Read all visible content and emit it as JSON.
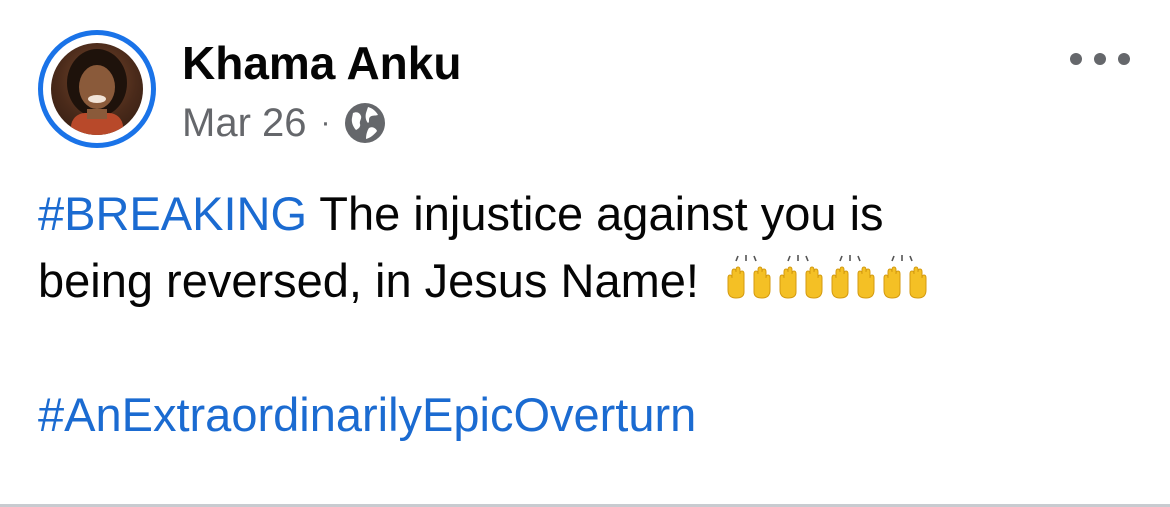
{
  "post": {
    "author": "Khama Anku",
    "date": "Mar 26",
    "separator": "·",
    "audience_icon": "globe-icon",
    "more_icon": "more-horizontal-icon",
    "text": {
      "hashtag_1": "#BREAKING",
      "line_1_rest": " The injustice against you is",
      "line_2": "being reversed, in Jesus Name! ",
      "emoji_name": "raising-hands-emoji",
      "emoji_count": 4,
      "hashtag_2": "#AnExtraordinarilyEpicOverturn"
    }
  },
  "colors": {
    "accent": "#1a73e8",
    "hashtag": "#1b6bd1",
    "text": "#050505",
    "secondary": "#65676b",
    "emoji": "#f4c025"
  }
}
